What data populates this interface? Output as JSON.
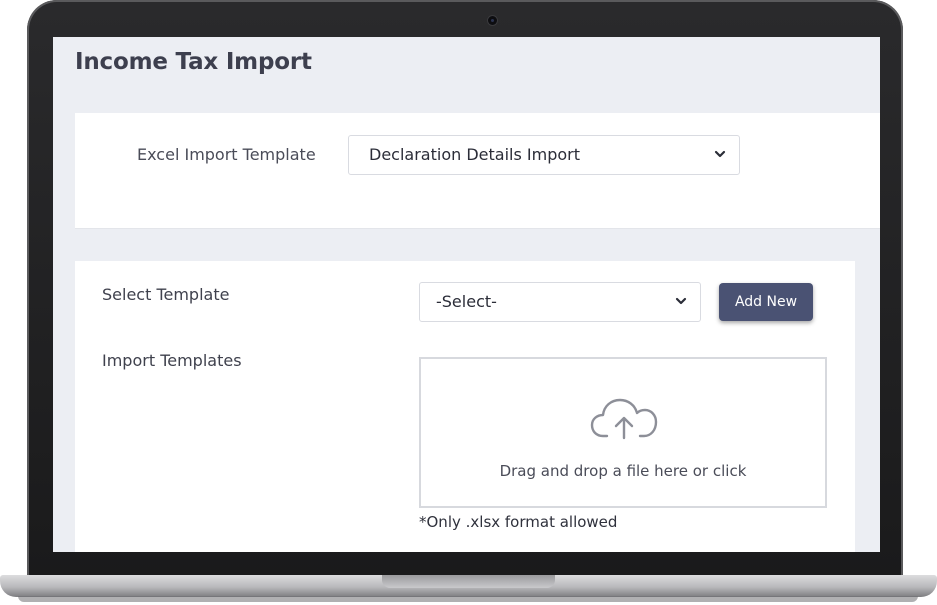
{
  "page": {
    "title": "Income Tax Import"
  },
  "excel_import": {
    "label": "Excel Import Template",
    "selected": "Declaration Details Import"
  },
  "template_section": {
    "select_label": "Select Template",
    "select_value": "-Select-",
    "add_new_label": "Add New",
    "import_label": "Import Templates",
    "dropzone_text": "Drag and drop a file here or click",
    "format_note": "*Only .xlsx format allowed"
  },
  "icons": {
    "upload": "cloud-upload-icon",
    "dropdown": "chevron-down-icon"
  },
  "colors": {
    "accent_button": "#4a5273",
    "page_background": "#eceef3",
    "title_text": "#3d3f4e"
  }
}
